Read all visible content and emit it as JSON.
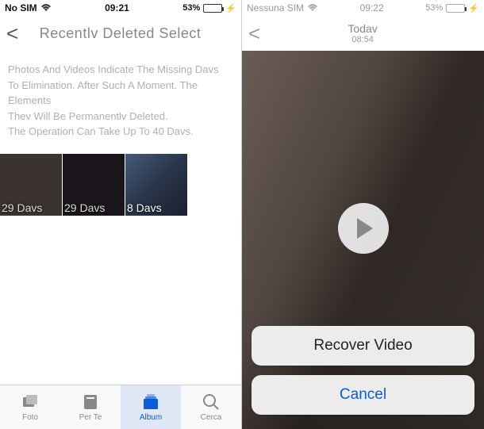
{
  "left": {
    "status": {
      "carrier": "No SIM",
      "time": "09:21",
      "battery_pct": "53%"
    },
    "nav": {
      "title": "Recentlv Deleted Select"
    },
    "info": {
      "line1": "Photos And Videos Indicate The Missing Davs",
      "line2": "To Elimination. After Such A Moment. The Elements",
      "line3": "Thev Will Be Permanentlv Deleted.",
      "line4": "The Operation Can Take Up To 40 Davs."
    },
    "thumbs": [
      {
        "label": "29 Davs"
      },
      {
        "label": "29 Davs"
      },
      {
        "label": "8 Davs"
      }
    ],
    "tabs": [
      {
        "label": "Foto"
      },
      {
        "label": "Per Te"
      },
      {
        "label": "Album"
      },
      {
        "label": "Cerca"
      }
    ]
  },
  "right": {
    "status": {
      "carrier": "Nessuna SIM",
      "time": "09:22",
      "battery_pct": "53%"
    },
    "nav": {
      "title": "Todav",
      "subtitle": "08:54"
    },
    "actions": {
      "recover": "Recover Video",
      "cancel": "Cancel"
    }
  }
}
